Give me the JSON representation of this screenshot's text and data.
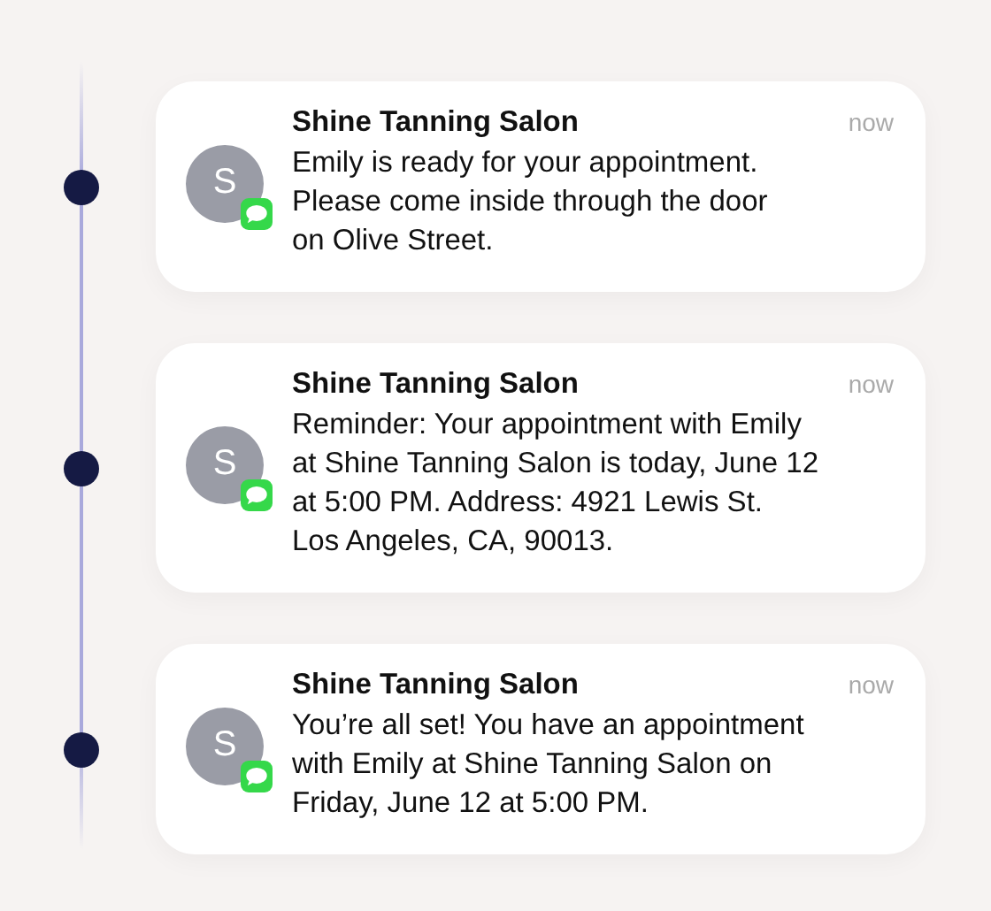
{
  "notifications": [
    {
      "avatar": "S",
      "sender": "Shine Tanning Salon",
      "time": "now",
      "body_lines": [
        "Emily is ready for your appointment.",
        "Please come inside through the door",
        "on Olive Street."
      ]
    },
    {
      "avatar": "S",
      "sender": "Shine Tanning Salon",
      "time": "now",
      "body_lines": [
        "Reminder: Your appointment with Emily",
        "at Shine Tanning Salon is today, June 12",
        "at 5:00 PM. Address: 4921 Lewis St.",
        "Los Angeles, CA, 90013."
      ]
    },
    {
      "avatar": "S",
      "sender": "Shine Tanning Salon",
      "time": "now",
      "body_lines": [
        "You’re all set! You have an appointment",
        "with Emily at Shine Tanning Salon on",
        "Friday, June 12 at 5:00 PM."
      ]
    }
  ]
}
